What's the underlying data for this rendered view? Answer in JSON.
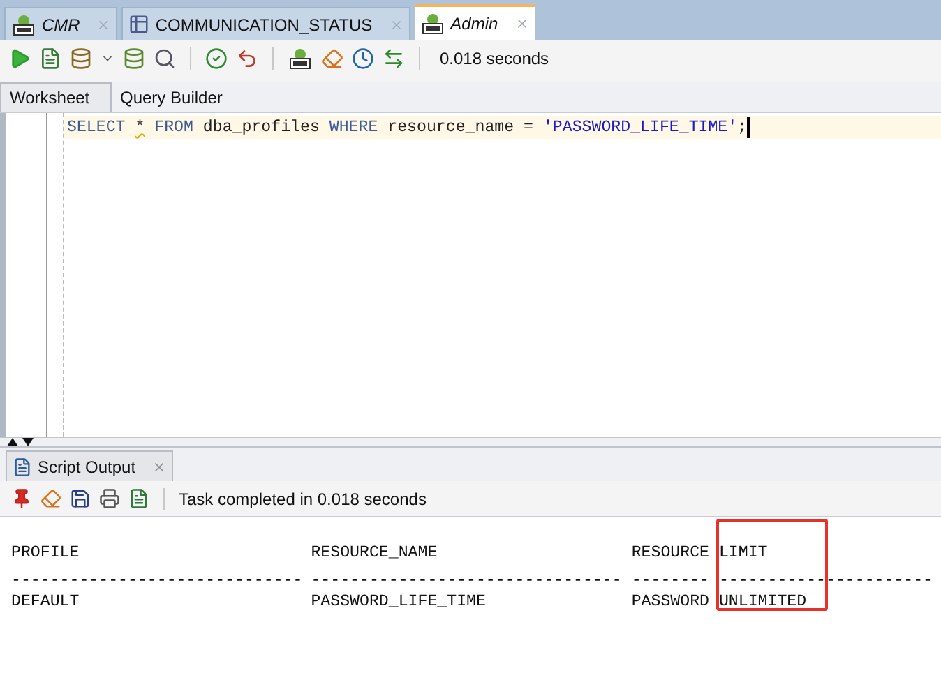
{
  "document_tabs": [
    {
      "label": "CMR",
      "kind": "sql",
      "selected": false
    },
    {
      "label": "COMMUNICATION_STATUS",
      "kind": "table",
      "selected": false
    },
    {
      "label": "Admin",
      "kind": "sql",
      "selected": true
    }
  ],
  "toolbar": {
    "elapsed": "0.018 seconds"
  },
  "editor_tabs": [
    {
      "label": "Worksheet",
      "selected": true
    },
    {
      "label": "Query Builder",
      "selected": false
    }
  ],
  "editor": {
    "tokens": [
      {
        "text": "SELECT ",
        "kind": "keyword"
      },
      {
        "text": "*",
        "kind": "warning"
      },
      {
        "text": " FROM",
        "kind": "keyword"
      },
      {
        "text": " dba_profiles ",
        "kind": "plain"
      },
      {
        "text": "WHERE",
        "kind": "keyword"
      },
      {
        "text": " resource_name = ",
        "kind": "plain"
      },
      {
        "text": "'PASSWORD_LIFE_TIME'",
        "kind": "string"
      },
      {
        "text": ";",
        "kind": "plain"
      }
    ]
  },
  "output_panel": {
    "tab": "Script Output",
    "status": "Task completed in 0.018 seconds"
  },
  "output": {
    "columns": [
      {
        "header": "PROFILE",
        "separator": "------------------------------",
        "highlighted": false
      },
      {
        "header": "RESOURCE_NAME",
        "separator": "--------------------------------",
        "highlighted": false
      },
      {
        "header": "RESOURCE",
        "separator": "--------",
        "highlighted": false
      },
      {
        "header": "LIMIT",
        "separator": "----------------------",
        "highlighted": true
      }
    ],
    "rows": [
      [
        "DEFAULT",
        "PASSWORD_LIFE_TIME",
        "PASSWORD",
        "UNLIMITED"
      ]
    ]
  }
}
